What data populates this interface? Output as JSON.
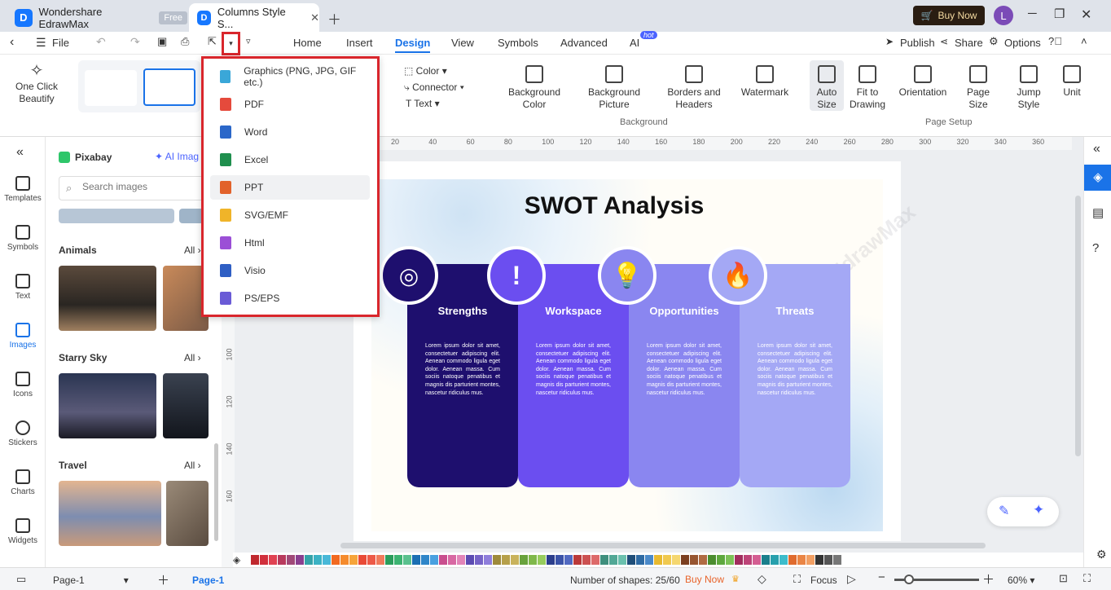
{
  "app": {
    "name": "Wondershare EdrawMax",
    "badge": "Free",
    "doc_tab": "Columns Style S...",
    "buy_now": "Buy Now",
    "avatar": "L"
  },
  "menubar": {
    "file": "File",
    "tabs": [
      "Home",
      "Insert",
      "Design",
      "View",
      "Symbols",
      "Advanced",
      "AI"
    ],
    "ai_badge": "hot",
    "publish": "Publish",
    "share": "Share",
    "options": "Options"
  },
  "ribbon": {
    "one_click": "One Click Beautify",
    "color": "Color",
    "connector": "Connector",
    "text": "Text",
    "background_color": "Background Color",
    "background_picture": "Background Picture",
    "borders_headers": "Borders and Headers",
    "watermark": "Watermark",
    "auto_size": "Auto Size",
    "fit_to_drawing": "Fit to Drawing",
    "orientation": "Orientation",
    "page_size": "Page Size",
    "jump_style": "Jump Style",
    "unit": "Unit",
    "group_background": "Background",
    "group_page_setup": "Page Setup"
  },
  "export_menu": {
    "items": [
      "Graphics (PNG, JPG, GIF etc.)",
      "PDF",
      "Word",
      "Excel",
      "PPT",
      "SVG/EMF",
      "Html",
      "Visio",
      "PS/EPS"
    ],
    "hovered": "PPT"
  },
  "left_rail": [
    "Templates",
    "Symbols",
    "Text",
    "Images",
    "Icons",
    "Stickers",
    "Charts",
    "Widgets"
  ],
  "images_panel": {
    "source": "Pixabay",
    "ai_label": "AI Imag",
    "search_placeholder": "Search images",
    "sections": [
      {
        "title": "Animals",
        "all": "All"
      },
      {
        "title": "Starry Sky",
        "all": "All"
      },
      {
        "title": "Travel",
        "all": "All"
      }
    ]
  },
  "ruler_h": [
    "20",
    "40",
    "60",
    "80",
    "100",
    "120",
    "140",
    "160",
    "180",
    "200",
    "220",
    "240",
    "260",
    "280",
    "300",
    "320",
    "340",
    "360"
  ],
  "ruler_v": [
    "100",
    "120",
    "140",
    "160"
  ],
  "swot": {
    "title": "SWOT Analysis",
    "columns": [
      {
        "title": "Strengths",
        "color": "#1e0f6e"
      },
      {
        "title": "Workspace",
        "color": "#6b4ef0"
      },
      {
        "title": "Opportunities",
        "color": "#8a86f0"
      },
      {
        "title": "Threats",
        "color": "#a4a8f5"
      }
    ],
    "body": "Lorem ipsum dolor sit amet, consectetuer adipiscing elit. Aenean commodo ligula eget dolor. Aenean massa. Cum sociis natoque penatibus et magnis dis parturient montes, nascetur ridiculus mus.",
    "watermark": "Wondershare EdrawMax"
  },
  "status": {
    "page_select": "Page-1",
    "page_tab": "Page-1",
    "shapes": "Number of shapes: 25/60",
    "buy_now": "Buy Now",
    "focus": "Focus",
    "zoom": "60%"
  },
  "palette": [
    "#c0282e",
    "#d12f3c",
    "#e04252",
    "#b83a5d",
    "#a04978",
    "#8a3f8f",
    "#35a3a8",
    "#3cb2c4",
    "#49b8d8",
    "#f26a21",
    "#f58b2d",
    "#f6a43a",
    "#e94a36",
    "#ed5a48",
    "#f07a5c",
    "#2a9d5c",
    "#3cb371",
    "#5ac18e",
    "#1b6fb3",
    "#2f86c9",
    "#49a0e0",
    "#c94e8e",
    "#d868a3",
    "#e284b8",
    "#5c4bb2",
    "#7663c7",
    "#8f7edb",
    "#9e8a3b",
    "#b6a04a",
    "#c9b35c",
    "#68a23c",
    "#7fb84a",
    "#97cc5d",
    "#2c3e8c",
    "#3b53a8",
    "#5169c1",
    "#ba3939",
    "#cc5151",
    "#dd6a6a",
    "#3f8f7d",
    "#52a896",
    "#6bc1ae",
    "#1f4e79",
    "#2e6aa3",
    "#4a89c9",
    "#e8b92f",
    "#f0c94f",
    "#f5d770",
    "#7b3f20",
    "#975530",
    "#b06b43",
    "#4b8d2f",
    "#5ea83e",
    "#7cc257",
    "#a12d5e",
    "#bd4478",
    "#d45e92",
    "#1a7f8c",
    "#27a0ad",
    "#3dbccb",
    "#e06b2e",
    "#ea8545",
    "#f29f63",
    "#333333",
    "#555555",
    "#777777"
  ]
}
